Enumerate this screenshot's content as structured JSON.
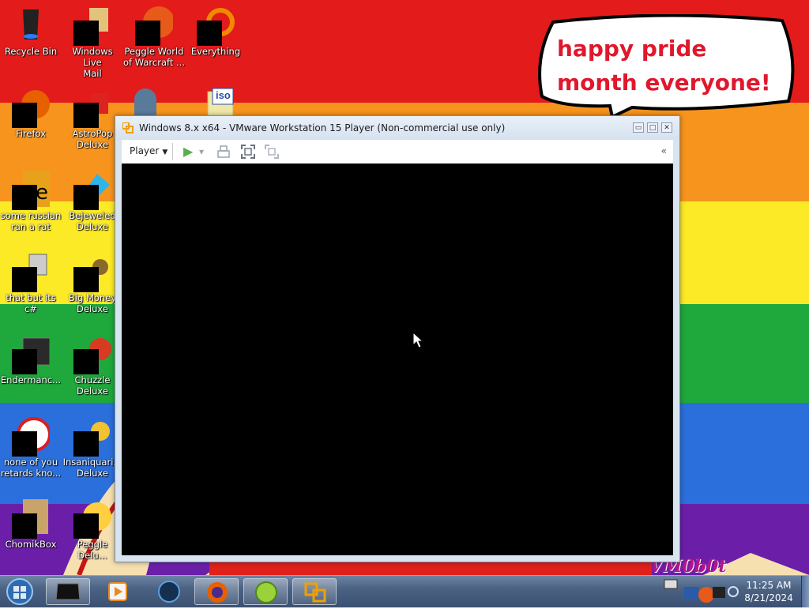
{
  "desktop": {
    "stripes": [
      "#e31b1b",
      "#f7941d",
      "#fdea26",
      "#1fa83b",
      "#2b6fdc",
      "#6b1fa8"
    ],
    "icons": [
      {
        "label": "Recycle Bin",
        "icon": "recycle-bin-icon"
      },
      {
        "label": "Windows Live\nMail",
        "icon": "mail-icon"
      },
      {
        "label": "Peggle World\nof Warcraft ...",
        "icon": "peggle-icon"
      },
      {
        "label": "Everything",
        "icon": "everything-search-icon"
      },
      {
        "label": "Firefox",
        "icon": "firefox-icon"
      },
      {
        "label": "AstroPop\nDeluxe",
        "icon": "astropop-icon"
      },
      {
        "label": "some russian\nran a rat",
        "icon": "file-icon"
      },
      {
        "label": "Bejeweled\nDeluxe",
        "icon": "bejeweled-icon"
      },
      {
        "label": "that but its c#",
        "icon": "file-icon"
      },
      {
        "label": "Big Money\nDeluxe",
        "icon": "big-money-icon"
      },
      {
        "label": "Endermanc...",
        "icon": "app-window-icon"
      },
      {
        "label": "Chuzzle\nDeluxe",
        "icon": "chuzzle-icon"
      },
      {
        "label": "none of you\nretards kno...",
        "icon": "app-icon"
      },
      {
        "label": "Insaniquari...\nDeluxe",
        "icon": "insaniquarium-icon"
      },
      {
        "label": "ChomikBox",
        "icon": "chomikbox-icon"
      },
      {
        "label": "Peggle Delu...",
        "icon": "peggle-icon"
      }
    ],
    "iso_badge": "iso",
    "bubble_text": "happy pride month everyone!",
    "watermark": "VM0b0t"
  },
  "vm_window": {
    "title": "Windows 8.x x64 - VMware Workstation 15 Player (Non-commercial use only)",
    "minimize": "▭",
    "maximize": "□",
    "close": "✕",
    "player_menu": "Player",
    "player_caret": "▼",
    "play": "▶",
    "play_caret": "▾",
    "collapse": "«"
  },
  "taskbar": {
    "items": [
      "start-orb",
      "media-center-icon",
      "media-player-icon",
      "world-icon",
      "firefox-icon",
      "lime-icon",
      "vmware-icon"
    ],
    "clock_time": "11:25 AM",
    "clock_date": "8/21/2024"
  }
}
